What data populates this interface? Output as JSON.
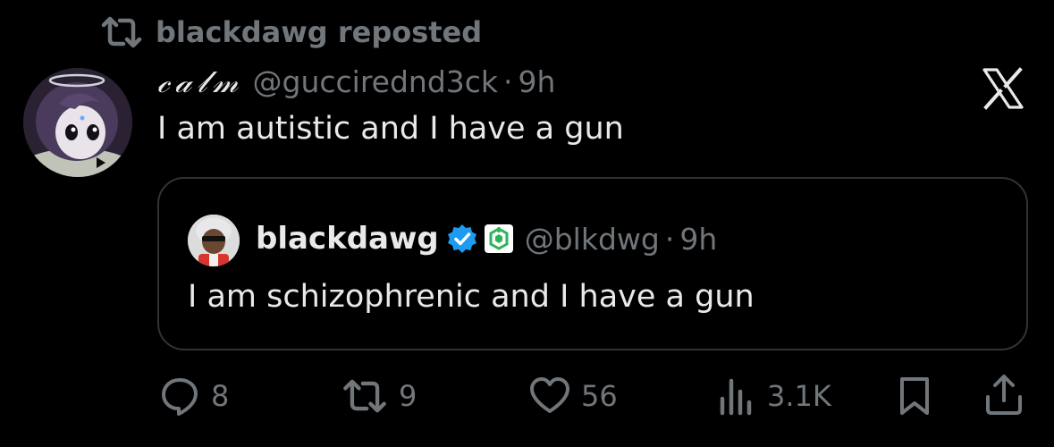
{
  "repost": {
    "label": "blackdawg reposted",
    "icon": "repost-icon"
  },
  "tweet": {
    "display_name": "𝒸𝒶𝓁𝓂",
    "handle": "@guccirednd3ck",
    "separator": "·",
    "time": "9h",
    "text": "I am autistic and I have a gun",
    "platform_icon": "x-logo-icon"
  },
  "quote": {
    "name": "blackdawg",
    "handle": "@blkdwg",
    "separator": "·",
    "time": "9h",
    "text": "I am schizophrenic and I have a gun",
    "badges": [
      "verified-icon",
      "affiliate-badge-icon"
    ]
  },
  "actions": {
    "replies": "8",
    "reposts": "9",
    "likes": "56",
    "views": "3.1K"
  },
  "colors": {
    "background": "#000000",
    "primary_text": "#e7e9ea",
    "secondary_text": "#71767b",
    "border": "#2f3336",
    "verified_blue": "#1d9bf0",
    "affiliate_green": "#2fb35a"
  }
}
